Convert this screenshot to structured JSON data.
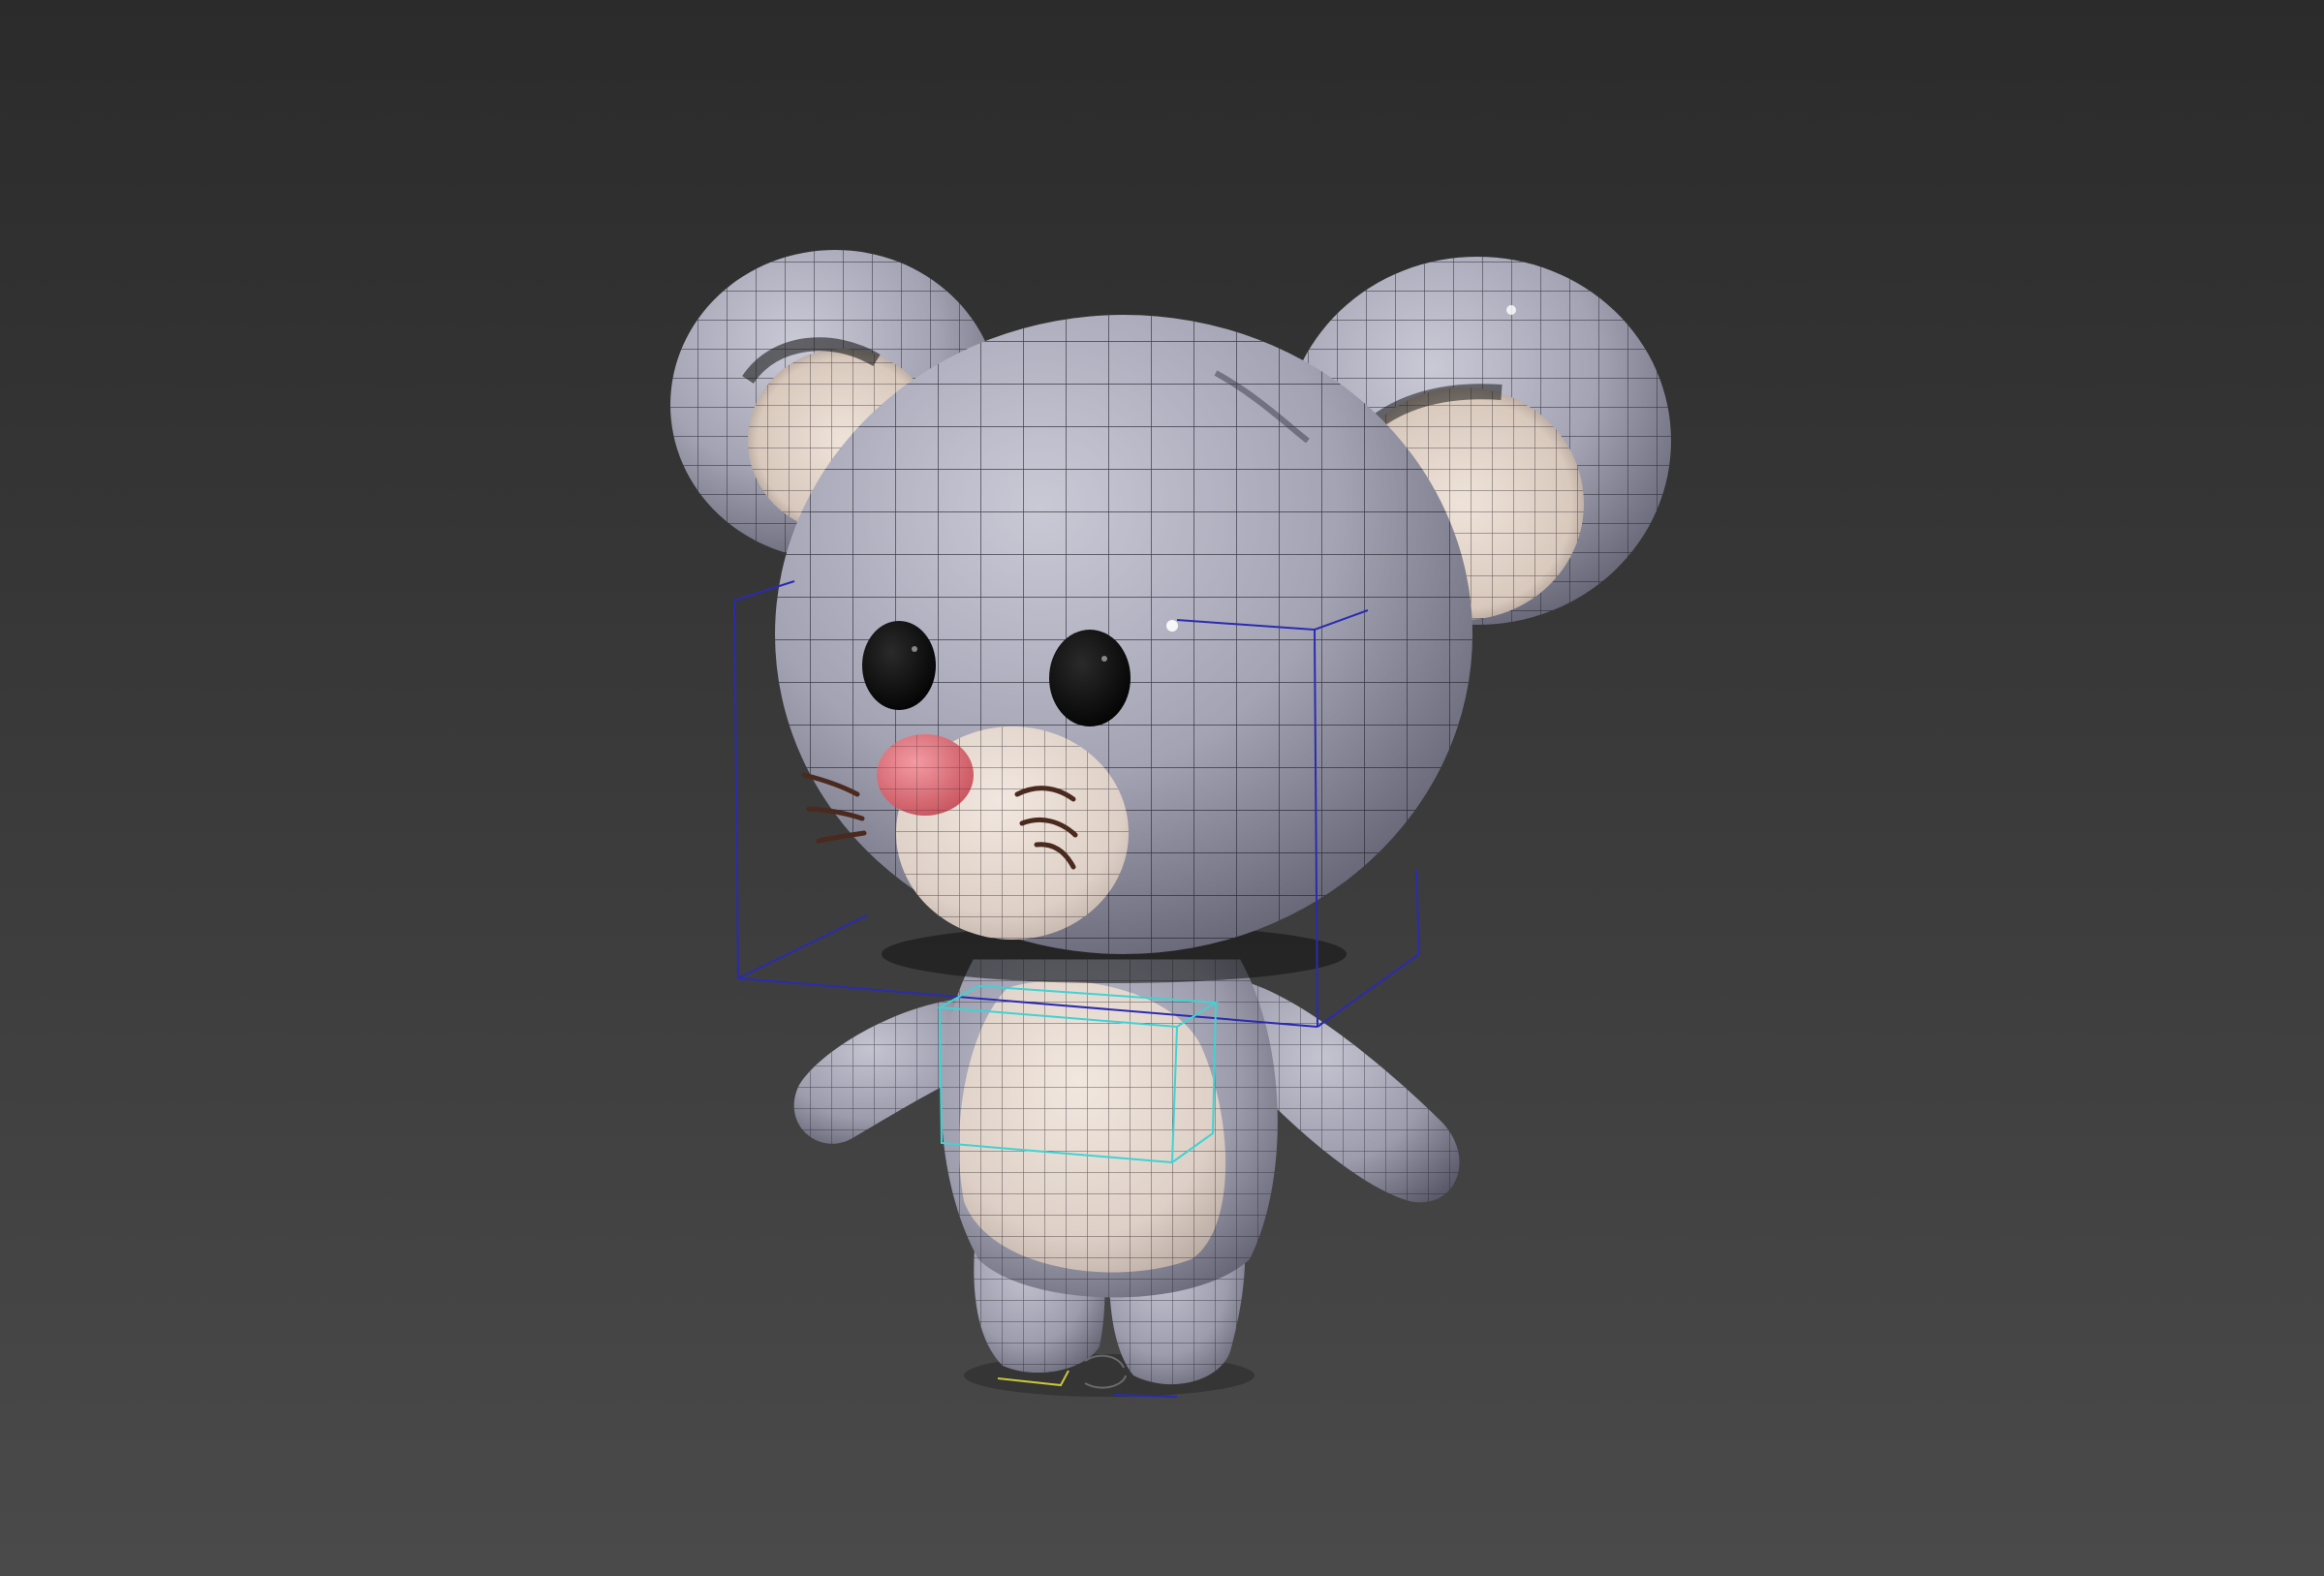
{
  "viewport": {
    "background_top": "#2b2b2b",
    "background_bottom": "#4a4a4a",
    "view_mode": "perspective",
    "shading": "smooth-with-wireframe"
  },
  "model": {
    "subject": "cartoon mouse",
    "selected": true,
    "colors": {
      "fur": "#a7a7b8",
      "fur_shadow": "#6c6c7c",
      "belly": "#e6d8cf",
      "inner_ear": "#e2d3c8",
      "nose": "#e0707a",
      "eyes": "#0a0a0a",
      "whiskers": "#4a2a1e",
      "wire": "#1e1e26",
      "gizmo_head": "#2b2bb0",
      "gizmo_body": "#3fd3d3",
      "pivot": "#c8c83a"
    }
  }
}
